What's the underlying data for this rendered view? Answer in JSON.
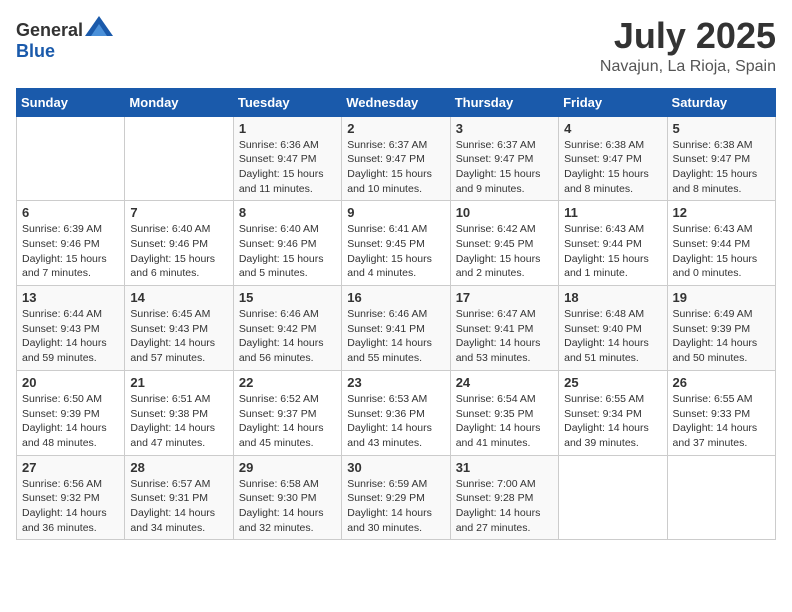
{
  "logo": {
    "general": "General",
    "blue": "Blue"
  },
  "title": {
    "month": "July 2025",
    "location": "Navajun, La Rioja, Spain"
  },
  "columns": [
    "Sunday",
    "Monday",
    "Tuesday",
    "Wednesday",
    "Thursday",
    "Friday",
    "Saturday"
  ],
  "weeks": [
    [
      {
        "day": "",
        "info": ""
      },
      {
        "day": "",
        "info": ""
      },
      {
        "day": "1",
        "info": "Sunrise: 6:36 AM\nSunset: 9:47 PM\nDaylight: 15 hours and 11 minutes."
      },
      {
        "day": "2",
        "info": "Sunrise: 6:37 AM\nSunset: 9:47 PM\nDaylight: 15 hours and 10 minutes."
      },
      {
        "day": "3",
        "info": "Sunrise: 6:37 AM\nSunset: 9:47 PM\nDaylight: 15 hours and 9 minutes."
      },
      {
        "day": "4",
        "info": "Sunrise: 6:38 AM\nSunset: 9:47 PM\nDaylight: 15 hours and 8 minutes."
      },
      {
        "day": "5",
        "info": "Sunrise: 6:38 AM\nSunset: 9:47 PM\nDaylight: 15 hours and 8 minutes."
      }
    ],
    [
      {
        "day": "6",
        "info": "Sunrise: 6:39 AM\nSunset: 9:46 PM\nDaylight: 15 hours and 7 minutes."
      },
      {
        "day": "7",
        "info": "Sunrise: 6:40 AM\nSunset: 9:46 PM\nDaylight: 15 hours and 6 minutes."
      },
      {
        "day": "8",
        "info": "Sunrise: 6:40 AM\nSunset: 9:46 PM\nDaylight: 15 hours and 5 minutes."
      },
      {
        "day": "9",
        "info": "Sunrise: 6:41 AM\nSunset: 9:45 PM\nDaylight: 15 hours and 4 minutes."
      },
      {
        "day": "10",
        "info": "Sunrise: 6:42 AM\nSunset: 9:45 PM\nDaylight: 15 hours and 2 minutes."
      },
      {
        "day": "11",
        "info": "Sunrise: 6:43 AM\nSunset: 9:44 PM\nDaylight: 15 hours and 1 minute."
      },
      {
        "day": "12",
        "info": "Sunrise: 6:43 AM\nSunset: 9:44 PM\nDaylight: 15 hours and 0 minutes."
      }
    ],
    [
      {
        "day": "13",
        "info": "Sunrise: 6:44 AM\nSunset: 9:43 PM\nDaylight: 14 hours and 59 minutes."
      },
      {
        "day": "14",
        "info": "Sunrise: 6:45 AM\nSunset: 9:43 PM\nDaylight: 14 hours and 57 minutes."
      },
      {
        "day": "15",
        "info": "Sunrise: 6:46 AM\nSunset: 9:42 PM\nDaylight: 14 hours and 56 minutes."
      },
      {
        "day": "16",
        "info": "Sunrise: 6:46 AM\nSunset: 9:41 PM\nDaylight: 14 hours and 55 minutes."
      },
      {
        "day": "17",
        "info": "Sunrise: 6:47 AM\nSunset: 9:41 PM\nDaylight: 14 hours and 53 minutes."
      },
      {
        "day": "18",
        "info": "Sunrise: 6:48 AM\nSunset: 9:40 PM\nDaylight: 14 hours and 51 minutes."
      },
      {
        "day": "19",
        "info": "Sunrise: 6:49 AM\nSunset: 9:39 PM\nDaylight: 14 hours and 50 minutes."
      }
    ],
    [
      {
        "day": "20",
        "info": "Sunrise: 6:50 AM\nSunset: 9:39 PM\nDaylight: 14 hours and 48 minutes."
      },
      {
        "day": "21",
        "info": "Sunrise: 6:51 AM\nSunset: 9:38 PM\nDaylight: 14 hours and 47 minutes."
      },
      {
        "day": "22",
        "info": "Sunrise: 6:52 AM\nSunset: 9:37 PM\nDaylight: 14 hours and 45 minutes."
      },
      {
        "day": "23",
        "info": "Sunrise: 6:53 AM\nSunset: 9:36 PM\nDaylight: 14 hours and 43 minutes."
      },
      {
        "day": "24",
        "info": "Sunrise: 6:54 AM\nSunset: 9:35 PM\nDaylight: 14 hours and 41 minutes."
      },
      {
        "day": "25",
        "info": "Sunrise: 6:55 AM\nSunset: 9:34 PM\nDaylight: 14 hours and 39 minutes."
      },
      {
        "day": "26",
        "info": "Sunrise: 6:55 AM\nSunset: 9:33 PM\nDaylight: 14 hours and 37 minutes."
      }
    ],
    [
      {
        "day": "27",
        "info": "Sunrise: 6:56 AM\nSunset: 9:32 PM\nDaylight: 14 hours and 36 minutes."
      },
      {
        "day": "28",
        "info": "Sunrise: 6:57 AM\nSunset: 9:31 PM\nDaylight: 14 hours and 34 minutes."
      },
      {
        "day": "29",
        "info": "Sunrise: 6:58 AM\nSunset: 9:30 PM\nDaylight: 14 hours and 32 minutes."
      },
      {
        "day": "30",
        "info": "Sunrise: 6:59 AM\nSunset: 9:29 PM\nDaylight: 14 hours and 30 minutes."
      },
      {
        "day": "31",
        "info": "Sunrise: 7:00 AM\nSunset: 9:28 PM\nDaylight: 14 hours and 27 minutes."
      },
      {
        "day": "",
        "info": ""
      },
      {
        "day": "",
        "info": ""
      }
    ]
  ]
}
